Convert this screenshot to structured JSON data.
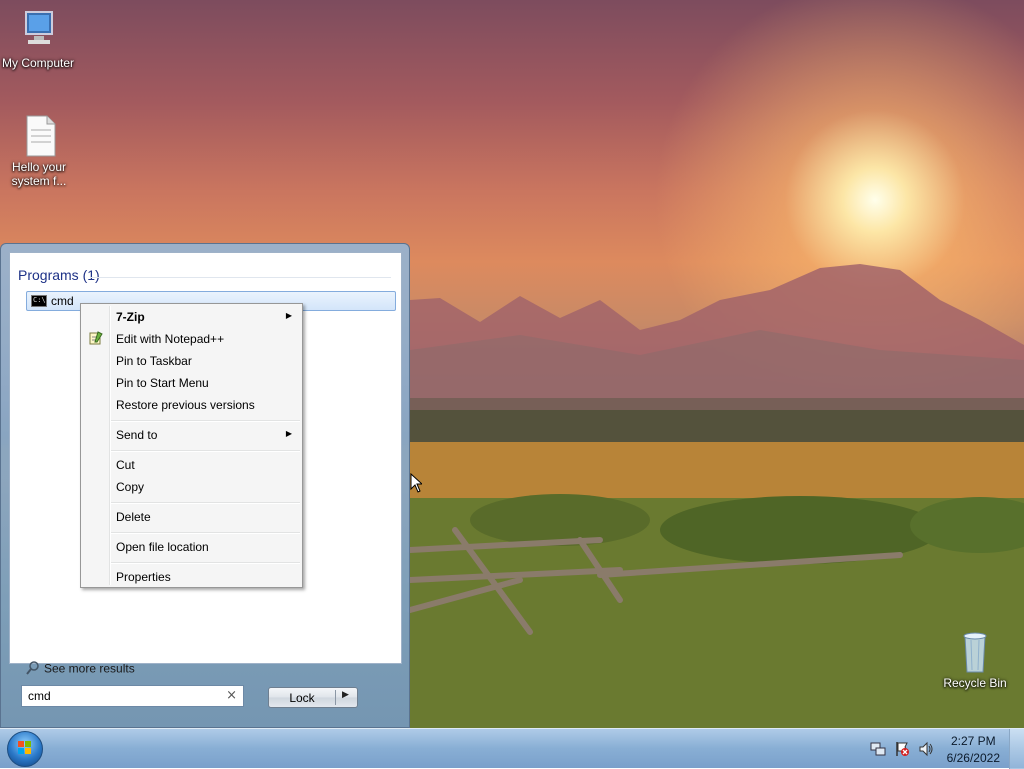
{
  "desktop": {
    "icons": [
      {
        "label": "My Computer",
        "icon": "computer-icon"
      },
      {
        "label_line1": "Hello your",
        "label_line2": "system f...",
        "icon": "document-icon"
      },
      {
        "label": "Recycle Bin",
        "icon": "recycle-bin-icon"
      }
    ]
  },
  "start_menu": {
    "section_title": "Programs (1)",
    "program_item": {
      "label": "cmd",
      "icon": "cmd-icon"
    },
    "see_more": "See more results",
    "search": {
      "value": "cmd",
      "clear_glyph": "×"
    },
    "lock_button": {
      "label": "Lock",
      "arrow": "▶"
    }
  },
  "context_menu": {
    "items": [
      {
        "label": "7-Zip",
        "bold": true,
        "submenu": true
      },
      {
        "label": "Edit with Notepad++",
        "icon": "notepad-plus-plus-icon"
      },
      {
        "label": "Pin to Taskbar"
      },
      {
        "label": "Pin to Start Menu"
      },
      {
        "label": "Restore previous versions"
      },
      {
        "label": "Send to",
        "submenu": true
      },
      {
        "label": "Cut"
      },
      {
        "label": "Copy"
      },
      {
        "label": "Delete"
      },
      {
        "label": "Open file location"
      },
      {
        "label": "Properties"
      }
    ],
    "submenu_glyph": "▶"
  },
  "taskbar": {
    "start_icon": "windows-orb-icon",
    "clock": {
      "time": "2:27 PM",
      "date": "6/26/2022"
    },
    "tray_icons": [
      "network-icon",
      "action-center-flag-icon",
      "volume-icon"
    ]
  }
}
